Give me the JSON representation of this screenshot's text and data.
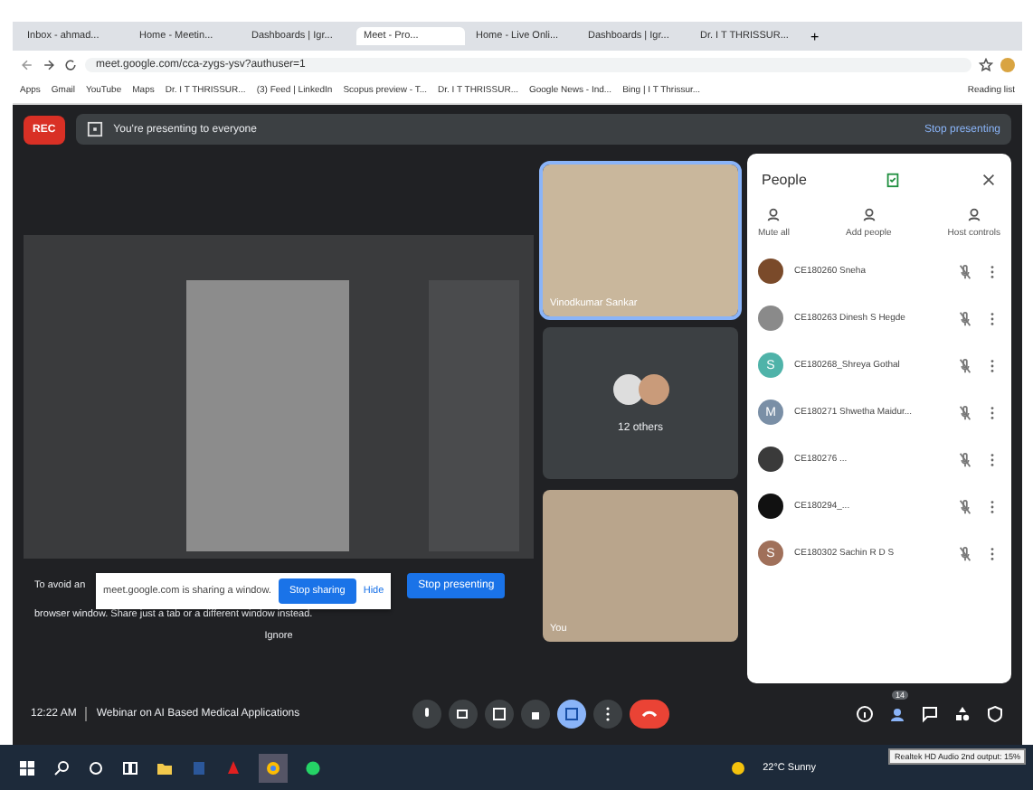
{
  "browser": {
    "tabs": [
      {
        "label": "Inbox - ahmad...",
        "selected": false
      },
      {
        "label": "Home - Meetin...",
        "selected": false
      },
      {
        "label": "Dashboards | Igr...",
        "selected": false
      },
      {
        "label": "Meet - Pro...",
        "selected": true
      },
      {
        "label": "Home - Live Onli...",
        "selected": false
      },
      {
        "label": "Dashboards | Igr...",
        "selected": false
      },
      {
        "label": "Dr. I T THRISSUR...",
        "selected": false
      }
    ],
    "new_tab": "+",
    "url": "meet.google.com/cca-zygs-ysv?authuser=1",
    "bookmarks": [
      "Apps",
      "Gmail",
      "YouTube",
      "Maps",
      "Dr. I T THRISSUR...",
      "(3) Feed | LinkedIn",
      "Scopus preview - T...",
      "Dr. I T THRISSUR...",
      "Google News - Ind...",
      "Bing | I T Thrissur..."
    ],
    "reading_list": "Reading list"
  },
  "meet": {
    "rec": "REC",
    "presenting_banner": "You're presenting to everyone",
    "stop_presenting_link": "Stop presenting",
    "tiles": [
      {
        "kind": "video",
        "name": "Vinodkumar Sankar",
        "highlighted": true
      },
      {
        "kind": "others",
        "name": "12 others",
        "highlighted": false
      },
      {
        "kind": "video",
        "name": "You",
        "highlighted": false
      }
    ],
    "warning": {
      "text_start": "To avoid an",
      "text_end": "browser window. Share just a tab or a different window instead.",
      "stop_presenting": "Stop presenting",
      "ignore": "Ignore"
    },
    "share_bar": {
      "message": "meet.google.com is sharing a window.",
      "stop": "Stop sharing",
      "hide": "Hide"
    },
    "time": "12:22 AM",
    "meeting_title": "Webinar on AI Based Medical Applications",
    "people_count": "14"
  },
  "people": {
    "title": "People",
    "actions": [
      "Mute all",
      "Add people",
      "Host controls"
    ],
    "participants": [
      {
        "name": "CE180260 Sneha",
        "kind": "photo",
        "color": "#7a4a2a"
      },
      {
        "name": "CE180263 Dinesh S Hegde",
        "kind": "photo",
        "color": "#8a8a8a"
      },
      {
        "name": "CE180268_Shreya Gothal",
        "kind": "letter",
        "initial": "S",
        "color": "#4fb3a9"
      },
      {
        "name": "CE180271 Shwetha Maidur...",
        "kind": "letter",
        "initial": "M",
        "color": "#7a8fa6"
      },
      {
        "name": "CE180276 ...",
        "kind": "photo",
        "color": "#3a3a3a"
      },
      {
        "name": "CE180294_...",
        "kind": "photo",
        "color": "#111111"
      },
      {
        "name": "CE180302 Sachin R D S",
        "kind": "letter",
        "initial": "S",
        "color": "#a0705a"
      }
    ]
  },
  "taskbar": {
    "weather": "22°C Sunny",
    "tooltip": "Realtek HD Audio 2nd output: 15%"
  }
}
